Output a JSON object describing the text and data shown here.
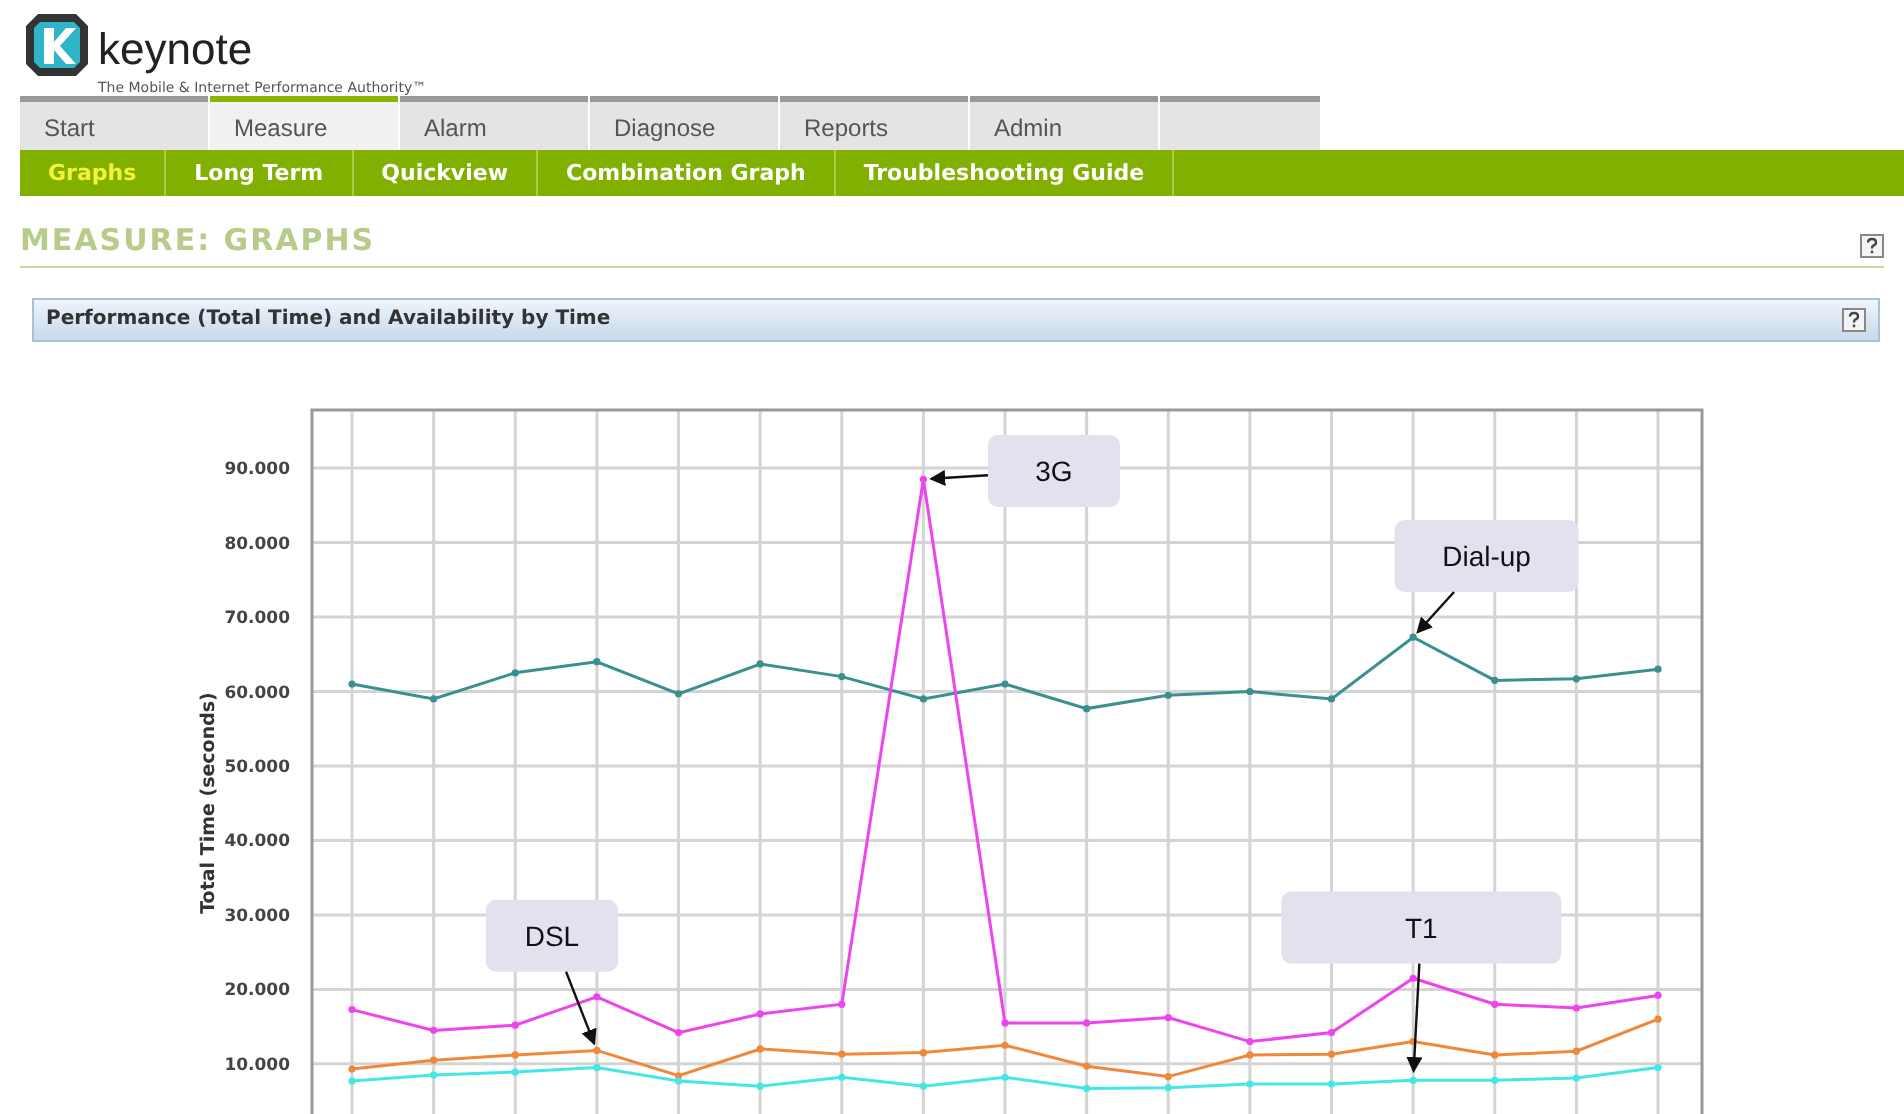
{
  "header": {
    "brand": "keynote",
    "tagline": "The Mobile & Internet Performance Authority™"
  },
  "tabs": [
    {
      "label": "Start",
      "selected": false
    },
    {
      "label": "Measure",
      "selected": true
    },
    {
      "label": "Alarm",
      "selected": false
    },
    {
      "label": "Diagnose",
      "selected": false
    },
    {
      "label": "Reports",
      "selected": false
    },
    {
      "label": "Admin",
      "selected": false
    }
  ],
  "subnav": [
    {
      "label": "Graphs",
      "selected": true
    },
    {
      "label": "Long Term",
      "selected": false
    },
    {
      "label": "Quickview",
      "selected": false
    },
    {
      "label": "Combination Graph",
      "selected": false
    },
    {
      "label": "Troubleshooting Guide",
      "selected": false
    }
  ],
  "page_title": "MEASURE: GRAPHS",
  "panel": {
    "title": "Performance (Total Time) and Availability by Time",
    "chart_data": {
      "type": "line",
      "grid": true,
      "ylabel": "Total Time (seconds)",
      "ylim": [
        3,
        97.8
      ],
      "yticks": [
        {
          "value": 10,
          "label": "10.000"
        },
        {
          "value": 20,
          "label": "20.000"
        },
        {
          "value": 30,
          "label": "30.000"
        },
        {
          "value": 40,
          "label": "40.000"
        },
        {
          "value": 50,
          "label": "50.000"
        },
        {
          "value": 60,
          "label": "60.000"
        },
        {
          "value": 70,
          "label": "70.000"
        },
        {
          "value": 80,
          "label": "80.000"
        },
        {
          "value": 90,
          "label": "90.000"
        }
      ],
      "series": [
        {
          "color": "#3a9090",
          "marker": "circle",
          "values": [
            61,
            59,
            62.5,
            64,
            59.7,
            63.7,
            62,
            59,
            61,
            57.7,
            59.5,
            60,
            59,
            67.3,
            61.5,
            61.7,
            63
          ]
        },
        {
          "color": "#ee44ee",
          "marker": "circle",
          "values": [
            17.3,
            14.5,
            15.2,
            19,
            14.2,
            16.7,
            18,
            88.5,
            15.5,
            15.5,
            16.2,
            13,
            14.2,
            21.5,
            18,
            17.5,
            19.2
          ]
        },
        {
          "color": "#f0883a",
          "marker": "circle",
          "values": [
            9.3,
            10.5,
            11.2,
            11.8,
            8.4,
            12,
            11.3,
            11.5,
            12.5,
            9.7,
            8.3,
            11.2,
            11.3,
            13,
            11.2,
            11.7,
            16
          ]
        },
        {
          "color": "#44e6e6",
          "marker": "circle",
          "values": [
            7.7,
            8.5,
            8.9,
            9.5,
            7.7,
            7,
            8.2,
            7,
            8.2,
            6.7,
            6.8,
            7.3,
            7.3,
            7.8,
            7.8,
            8.1,
            9.5
          ]
        }
      ],
      "annotations": [
        "3G",
        "Dial-up",
        "DSL",
        "T1"
      ]
    }
  }
}
